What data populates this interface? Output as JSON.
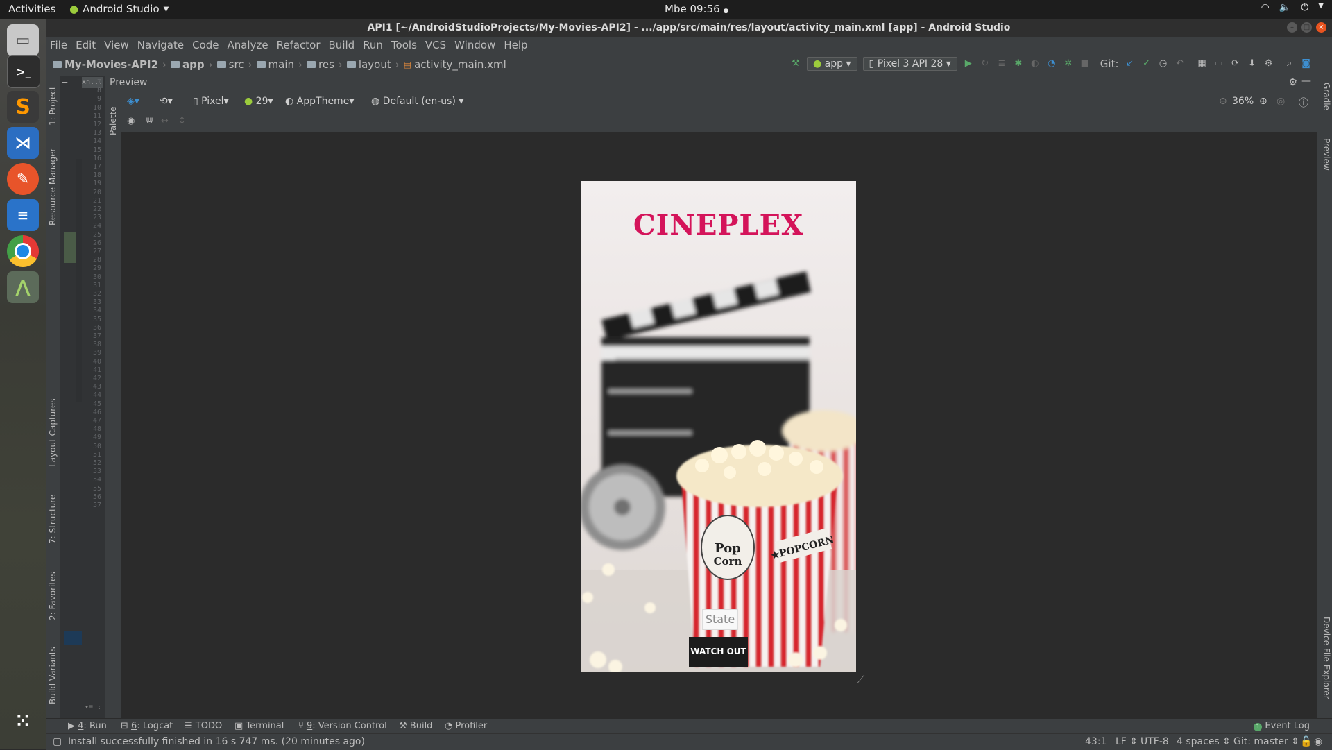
{
  "topbar": {
    "activities": "Activities",
    "app_name": "Android Studio",
    "clock": "Mbe 09:56"
  },
  "window": {
    "title": "API1 [~/AndroidStudioProjects/My-Movies-API2] - .../app/src/main/res/layout/activity_main.xml [app] - Android Studio"
  },
  "menu": [
    "File",
    "Edit",
    "View",
    "Navigate",
    "Code",
    "Analyze",
    "Refactor",
    "Build",
    "Run",
    "Tools",
    "VCS",
    "Window",
    "Help"
  ],
  "breadcrumbs": [
    "My-Movies-API2",
    "app",
    "src",
    "main",
    "res",
    "layout",
    "activity_main.xml"
  ],
  "run_config": {
    "module": "app",
    "device": "Pixel 3 API 28",
    "git_label": "Git:"
  },
  "left_tool_tabs": [
    "1: Project",
    "Resource Manager",
    "Layout Captures",
    "7: Structure",
    "2: Favorites",
    "Build Variants"
  ],
  "right_tool_tabs": [
    "Gradle",
    "Preview",
    "Device File Explorer"
  ],
  "gutter": {
    "tab_label": "xn...",
    "line_numbers": [
      "7",
      "8",
      "9",
      "10",
      "11",
      "12",
      "13",
      "14",
      "15",
      "16",
      "17",
      "18",
      "19",
      "20",
      "21",
      "22",
      "23",
      "24",
      "25",
      "26",
      "27",
      "28",
      "29",
      "30",
      "31",
      "32",
      "33",
      "34",
      "35",
      "36",
      "37",
      "38",
      "39",
      "40",
      "41",
      "42",
      "43",
      "44",
      "45",
      "46",
      "47",
      "48",
      "49",
      "50",
      "51",
      "52",
      "53",
      "54",
      "55",
      "56",
      "57"
    ]
  },
  "preview": {
    "header": "Preview",
    "palette_label": "Palette",
    "device_menu": "Pixel",
    "api_menu": "29",
    "theme_menu": "AppTheme",
    "locale_menu": "Default (en-us)",
    "zoom": "36%"
  },
  "app_screen": {
    "brand": "CINEPLEX",
    "state_hint": "State",
    "button_label": "WATCH OUT"
  },
  "bottom_tabs": [
    {
      "num": "4",
      "label": "Run"
    },
    {
      "num": "6",
      "label": "Logcat"
    },
    {
      "num": "",
      "label": "TODO"
    },
    {
      "num": "",
      "label": "Terminal"
    },
    {
      "num": "9",
      "label": "Version Control"
    },
    {
      "num": "",
      "label": "Build"
    },
    {
      "num": "",
      "label": "Profiler"
    }
  ],
  "event_log": "Event Log",
  "event_log_count": "1",
  "status": {
    "message": "Install successfully finished in 16 s 747 ms. (20 minutes ago)",
    "position": "43:1",
    "line_sep": "LF",
    "encoding": "UTF-8",
    "indent": "4 spaces",
    "git_branch": "Git: master"
  },
  "colors": {
    "brand": "#d4145a",
    "ide_bg": "#2b2b2b",
    "panel_bg": "#3c3f41",
    "button_bg": "#1c1c1c"
  }
}
